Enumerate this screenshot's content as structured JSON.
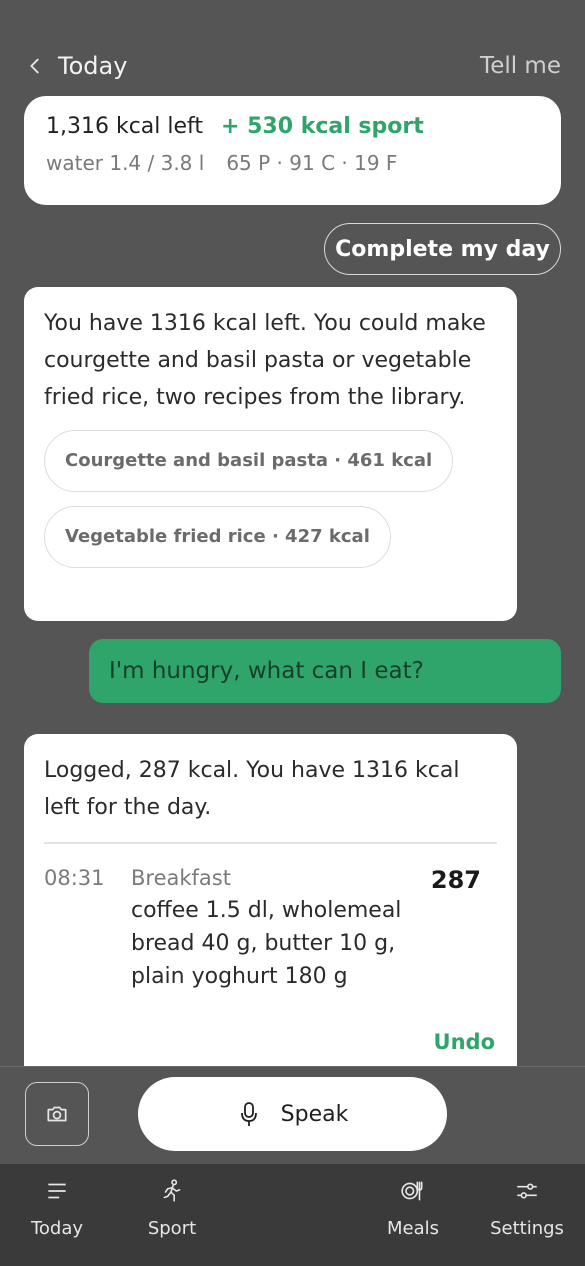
{
  "header": {
    "back_label": "Today",
    "tell_me": "Tell me"
  },
  "summary": {
    "kcal_left": "1,316 kcal left",
    "sport": "+ 530 kcal sport",
    "water": "water 1.4 / 3.8 l",
    "macros": "65 P · 91 C · 19 F"
  },
  "complete_day": "Complete my day",
  "messages": {
    "suggestion": {
      "text": "You have 1316 kcal left. You could make courgette and basil pasta or vegetable fried rice, two recipes from the library.",
      "chips": [
        "Courgette and basil pasta · 461 kcal",
        "Vegetable fried rice · 427 kcal"
      ]
    },
    "user": "I'm hungry, what can I eat?",
    "log": {
      "text": "Logged, 287 kcal. You have 1316 kcal left for the day.",
      "time": "08:31",
      "meal": "Breakfast",
      "items": "coffee 1.5 dl, wholemeal bread 40 g, butter 10 g, plain yoghurt 180 g",
      "kcal": "287",
      "undo": "Undo"
    }
  },
  "composer": {
    "speak_label": "Speak",
    "camera_icon": "camera-icon",
    "mic_icon": "microphone-icon"
  },
  "tabs": [
    {
      "label": "Today",
      "icon": "list-icon"
    },
    {
      "label": "Sport",
      "icon": "running-icon"
    },
    {
      "label": "Meals",
      "icon": "plate-fork-icon"
    },
    {
      "label": "Settings",
      "icon": "sliders-icon"
    }
  ],
  "colors": {
    "accent": "#2fa56b",
    "background": "#555555",
    "tabbar": "#3a3a3a"
  }
}
